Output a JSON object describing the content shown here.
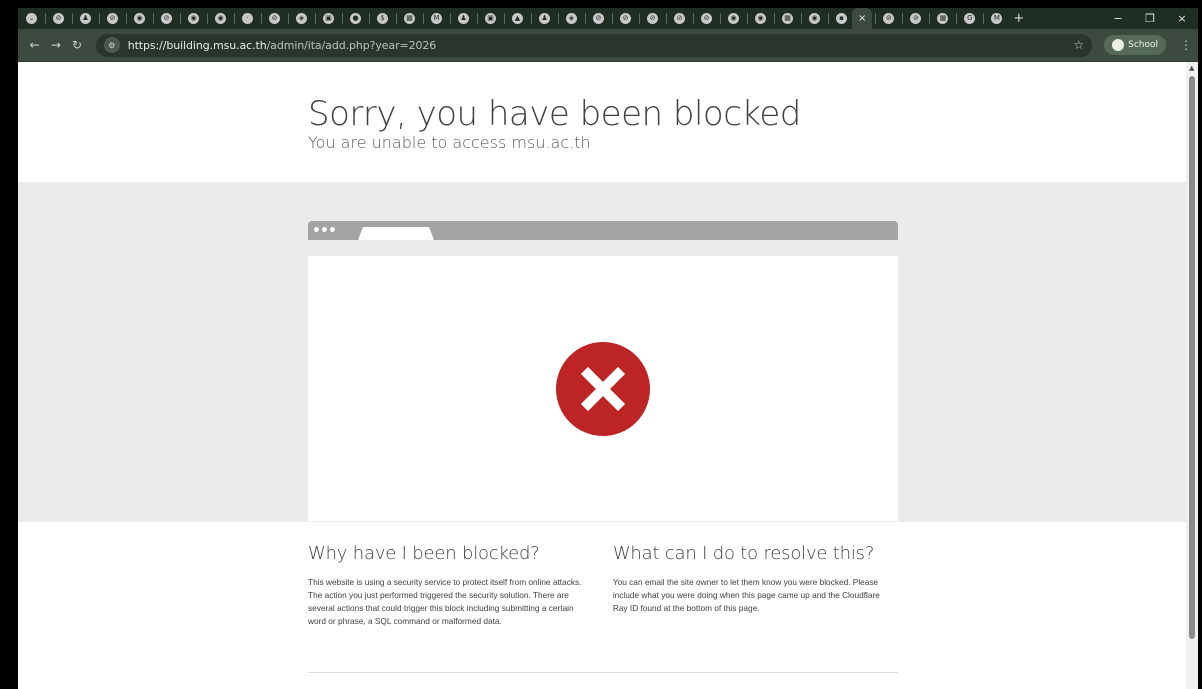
{
  "browser": {
    "tabs": [
      {
        "glyph": "⌄",
        "label": ""
      },
      {
        "glyph": "⊘",
        "label": ""
      },
      {
        "glyph": "♟",
        "label": ""
      },
      {
        "glyph": "⊘",
        "label": ""
      },
      {
        "glyph": "◉",
        "label": ""
      },
      {
        "glyph": "⊘",
        "label": ""
      },
      {
        "glyph": "◉",
        "label": ""
      },
      {
        "glyph": "◉",
        "label": ""
      },
      {
        "glyph": "·",
        "label": ""
      },
      {
        "glyph": "⊘",
        "label": ""
      },
      {
        "glyph": "◈",
        "label": ""
      },
      {
        "glyph": "▣",
        "label": ""
      },
      {
        "glyph": "●",
        "label": ""
      },
      {
        "glyph": "$",
        "label": ""
      },
      {
        "glyph": "▦",
        "label": ""
      },
      {
        "glyph": "M",
        "label": ""
      },
      {
        "glyph": "♟",
        "label": ""
      },
      {
        "glyph": "▣",
        "label": ""
      },
      {
        "glyph": "▲",
        "label": ""
      },
      {
        "glyph": "♟",
        "label": ""
      },
      {
        "glyph": "◈",
        "label": ""
      },
      {
        "glyph": "⊘",
        "label": ""
      },
      {
        "glyph": "⊘",
        "label": ""
      },
      {
        "glyph": "⊘",
        "label": ""
      },
      {
        "glyph": "⊘",
        "label": ""
      },
      {
        "glyph": "⊘",
        "label": ""
      },
      {
        "glyph": "◉",
        "label": ""
      },
      {
        "glyph": "◉",
        "label": ""
      },
      {
        "glyph": "▦",
        "label": ""
      },
      {
        "glyph": "◉",
        "label": ""
      },
      {
        "glyph": "▪",
        "label": ""
      }
    ],
    "active_tab_close": "×",
    "trailing_tabs": [
      {
        "glyph": "⊘"
      },
      {
        "glyph": "⊘"
      },
      {
        "glyph": "▦"
      },
      {
        "glyph": "G"
      },
      {
        "glyph": "M"
      }
    ],
    "new_tab": "+",
    "window_controls": {
      "minimize": "−",
      "restore": "❐",
      "close": "×"
    },
    "nav": {
      "back": "←",
      "forward": "→",
      "reload": "↻"
    },
    "site_info_icon": "⚙",
    "url_host": "https://building.msu.ac.th",
    "url_path": "/admin/ita/add.php?year=2026",
    "bookmark_star": "☆",
    "profile_label": "School",
    "menu": "⋮"
  },
  "page": {
    "title": "Sorry, you have been blocked",
    "subtitle": "You are unable to access msu.ac.th",
    "why_heading": "Why have I been blocked?",
    "why_body": "This website is using a security service to protect itself from online attacks. The action you just performed triggered the security solution. There are several actions that could trigger this block including submitting a certain word or phrase, a SQL command or malformed data.",
    "resolve_heading": "What can I do to resolve this?",
    "resolve_body": "You can email the site owner to let them know you were blocked. Please include what you were doing when this page came up and the Cloudflare Ray ID found at the bottom of this page."
  },
  "colors": {
    "chrome_dark": "#1f2e22",
    "chrome_toolbar": "#3c4a3f",
    "error_red": "#bd2426",
    "band_gray": "#ebebeb",
    "mock_bar_gray": "#a3a3a3"
  }
}
